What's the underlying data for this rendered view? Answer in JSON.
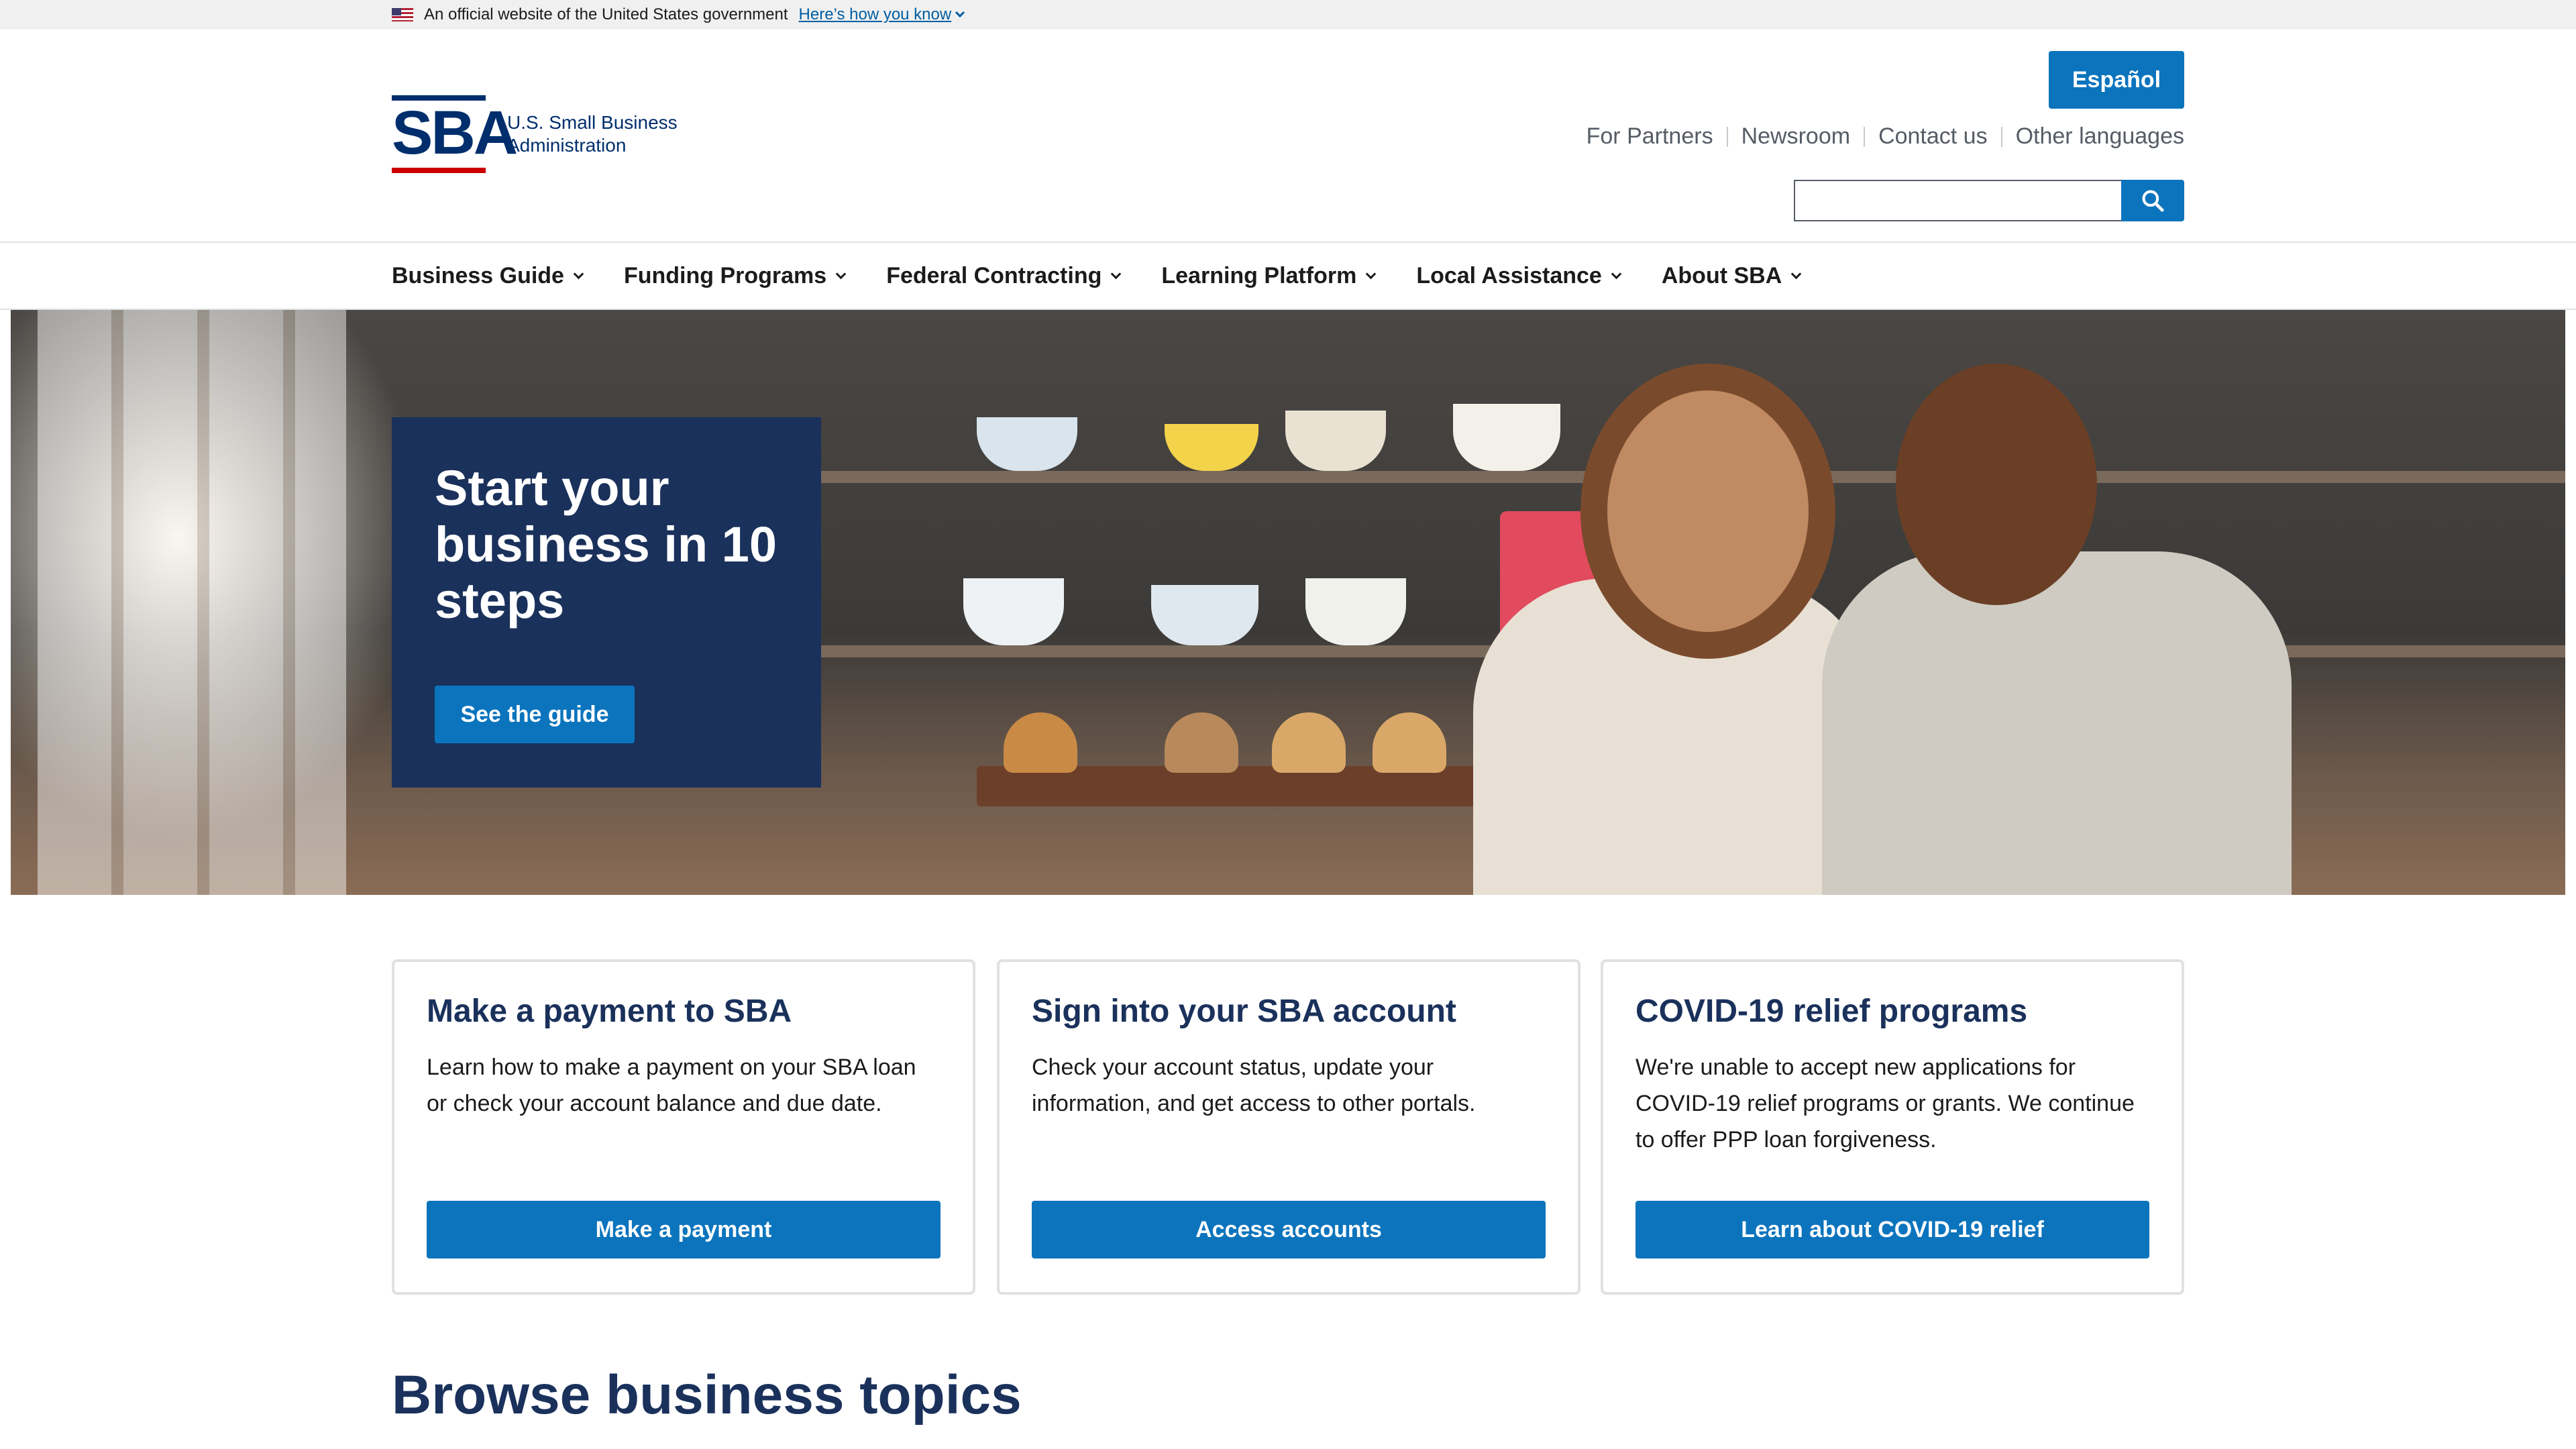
{
  "gov_banner": {
    "text": "An official website of the United States government",
    "link": "Here’s how you know"
  },
  "logo": {
    "mark": "SBA",
    "line1": "U.S. Small Business",
    "line2": "Administration"
  },
  "header": {
    "espanol_label": "Español",
    "util_links": [
      "For Partners",
      "Newsroom",
      "Contact us",
      "Other languages"
    ],
    "search_placeholder": ""
  },
  "nav": {
    "items": [
      "Business Guide",
      "Funding Programs",
      "Federal Contracting",
      "Learning Platform",
      "Local Assistance",
      "About SBA"
    ]
  },
  "hero": {
    "title": "Start your business in 10 steps",
    "button": "See the guide"
  },
  "cards": [
    {
      "title": "Make a payment to SBA",
      "body": "Learn how to make a payment on your SBA loan or check your account balance and due date.",
      "button": "Make a payment"
    },
    {
      "title": "Sign into your SBA account",
      "body": "Check your account status, update your information, and get access to other portals.",
      "button": "Access accounts"
    },
    {
      "title": "COVID-19 relief programs",
      "body": "We're unable to accept new applications for COVID-19 relief programs or grants. We continue to offer PPP loan forgiveness.",
      "button": "Learn about COVID-19 relief"
    }
  ],
  "browse_heading": "Browse business topics",
  "colors": {
    "primary": "#0b74bd",
    "navy": "#1a315b",
    "brand_blue": "#002e6d",
    "brand_red": "#cc0000"
  }
}
